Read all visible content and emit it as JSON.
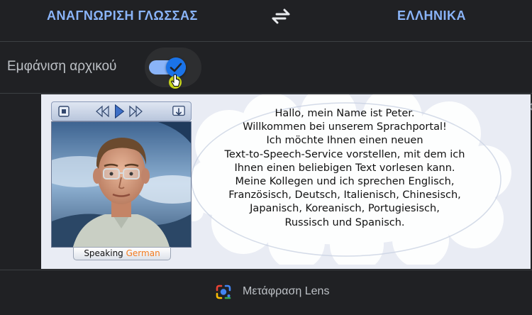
{
  "language_bar": {
    "source_label": "ΑΝΑΓΝΩΡΙΣΗ ΓΛΩΣΣΑΣ",
    "target_label": "ΕΛΛΗΝΙΚΑ",
    "swap_icon": "swap-horiz-icon"
  },
  "toggle": {
    "label": "Εμφάνιση αρχικού",
    "state": "on",
    "knob_icon": "check-icon"
  },
  "image": {
    "player_buttons": [
      "stop-icon",
      "rewind-icon",
      "play-icon",
      "fast-forward-icon",
      "download-icon"
    ],
    "speaking_prefix": "Speaking",
    "speaking_language": "German",
    "speech_lines": [
      "Hallo, mein Name ist Peter.",
      "Willkommen bei unserem Sprachportal!",
      "Ich möchte Ihnen einen neuen",
      "Text-to-Speech-Service vorstellen, mit dem ich",
      "Ihnen einen beliebigen Text vorlesen kann.",
      "Meine Kollegen und ich sprechen Englisch,",
      "Französisch, Deutsch, Italienisch, Chinesisch,",
      "Japanisch, Koreanisch, Portugiesisch,",
      "Russisch und Spanisch."
    ]
  },
  "lens": {
    "label": "Μετάφραση Lens",
    "icon": "google-lens-icon"
  },
  "colors": {
    "accent": "#8ab4f8",
    "background": "#202124",
    "speaking_language": "#f47c20"
  }
}
